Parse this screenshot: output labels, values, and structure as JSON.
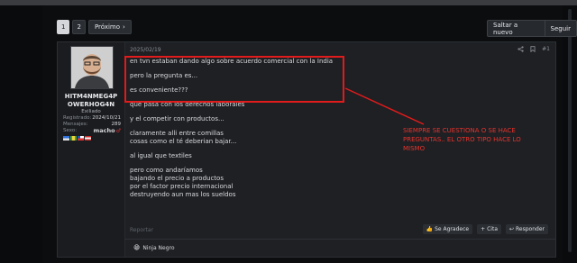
{
  "pagination": {
    "pages": [
      "1",
      "2"
    ],
    "next_label": "Próximo"
  },
  "actions": {
    "jump_new": "Saltar a nuevo",
    "follow": "Seguir"
  },
  "post": {
    "date": "2025/02/19",
    "number": "#1",
    "author": {
      "name": "HITM4NMEG4POWERHOG4N",
      "title": "Exiliado",
      "stats": [
        {
          "label": "Registrado:",
          "value": "2024/10/21"
        },
        {
          "label": "Mensajes:",
          "value": "289"
        },
        {
          "label": "Sexo:",
          "value": "macho"
        }
      ]
    },
    "lines": [
      "en tvn estaban dando algo sobre acuerdo comercial con la India",
      "",
      "pero la pregunta es...",
      "",
      "es conveniente???",
      "",
      "que pasa con los derechos laborales",
      "",
      "y el competir con productos...",
      "",
      "claramente alli entre comillas",
      "cosas como el té deberian bajar...",
      "",
      "al igual que textiles",
      "",
      "pero como andaríamos",
      "bajando el precio a productos",
      "por el factor precio internacional",
      "destruyendo aun mas los sueldos"
    ],
    "report_label": "Reportar",
    "reactions": {
      "like": "Se Agradece",
      "quote": "Cita",
      "reply": "Responder"
    },
    "reactor": "Ninja Negro"
  },
  "annotation": {
    "lines": [
      "SIEMPRE SE CUESTIONA O SE HACE",
      "PREGUNTAS.. EL OTRO TIPO HACE LO",
      "MISMO"
    ],
    "color": "#e8332c"
  }
}
